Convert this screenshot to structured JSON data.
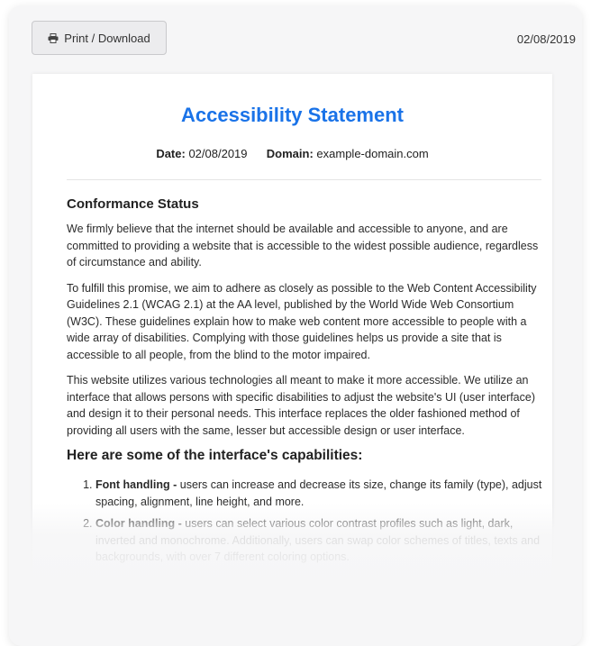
{
  "toolbar": {
    "print_label": "Print / Download",
    "date": "02/08/2019"
  },
  "statement": {
    "title": "Accessibility Statement",
    "date_label": "Date:",
    "date_value": "02/08/2019",
    "domain_label": "Domain:",
    "domain_value": "example-domain.com",
    "conformance_heading": "Conformance Status",
    "paragraphs": [
      "We firmly believe that the internet should be available and accessible to anyone, and are committed to providing a website that is accessible to the widest possible audience, regardless of circumstance and ability.",
      "To fulfill this promise, we aim to adhere as closely as possible to the Web Content Accessibility Guidelines 2.1 (WCAG 2.1) at the AA level, published by the World Wide Web Consortium (W3C). These guidelines explain how to make web content more accessible to people with a wide array of disabilities. Complying with those guidelines helps us provide a site that is accessible to all people, from the blind to the motor impaired.",
      "This website utilizes various technologies all meant to make it more accessible. We utilize an interface that allows persons with specific disabilities to adjust the website's UI (user interface) and design it to their personal needs. This interface replaces the older fashioned method of providing all users with the same, lesser but accessible design or user interface."
    ],
    "capabilities_heading": "Here are some of the interface's capabilities:",
    "capabilities": [
      {
        "name": "Font handling -",
        "text": " users can increase and decrease its size, change its family (type), adjust spacing, alignment, line height, and more."
      },
      {
        "name": "Color handling -",
        "text": " users can select various color contrast profiles such as light, dark, inverted and monochrome. Additionally, users can swap color schemes of titles, texts and backgrounds, with over 7 different coloring options."
      }
    ]
  }
}
